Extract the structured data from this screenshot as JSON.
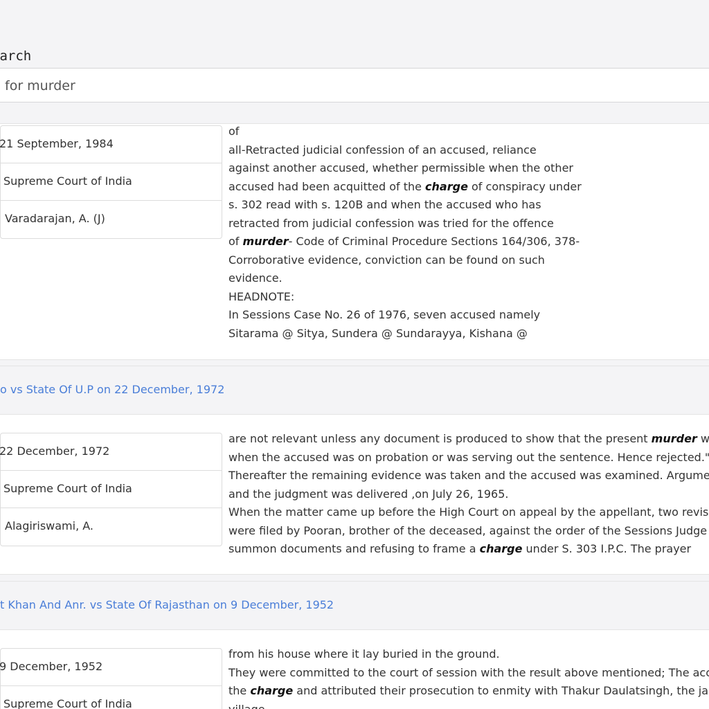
{
  "search": {
    "label": "earch",
    "query": "for murder"
  },
  "results": [
    {
      "title": "",
      "meta": {
        "date": "21 September, 1984",
        "court": "Supreme Court of India",
        "author": "Varadarajan, A. (J)"
      },
      "snippet_lines": [
        "of",
        "all-Retracted judicial confession of an accused, reliance",
        "against another accused, whether permissible when the other",
        [
          "accused had been acquitted of the ",
          {
            "em": "charge"
          },
          " of conspiracy under"
        ],
        "s. 302 read with s. 120B and when the accused who has",
        "retracted from judicial confession was tried for the offence",
        [
          "of ",
          {
            "em": "murder"
          },
          "- Code of Criminal Procedure Sections 164/306, 378-"
        ],
        "Corroborative evidence, conviction can be found on such",
        "evidence.",
        "HEADNOTE:",
        "In Sessions Case No. 26 of 1976, seven accused namely",
        "Sitarama @ Sitya, Sundera @ Sundarayya, Kishana @"
      ]
    },
    {
      "title": "o vs State Of U.P on 22 December, 1972",
      "meta": {
        "date": "22 December, 1972",
        "court": "Supreme Court of India",
        "author": "Alagiriswami, A."
      },
      "snippet_lines": [
        [
          "are not relevant unless any document is produced to show that the present ",
          {
            "em": "murder"
          },
          " was"
        ],
        "when the accused was on probation or was serving out the sentence. Hence rejected.\"",
        "Thereafter the remaining evidence was taken and the accused was examined. Arguments",
        "and the judgment was delivered ,on July 26, 1965.",
        "When the matter came up before the High Court on appeal by the appellant, two revisi",
        "were filed by Pooran, brother of the deceased, against the order of the Sessions Judge",
        [
          "summon documents and refusing to frame a ",
          {
            "em": "charge"
          },
          " under S. 303 I.P.C. The prayer"
        ]
      ]
    },
    {
      "title": "t Khan And Anr. vs State Of Rajasthan on 9 December, 1952",
      "meta": {
        "date": "9 December, 1952",
        "court": "Supreme Court of India",
        "author": ""
      },
      "snippet_lines": [
        "from his house where it lay buried in the ground.",
        "They were committed to the court of session with the result above mentioned; The accu",
        [
          "the ",
          {
            "em": "charge"
          },
          " and attributed their prosecution to enmity with Thakur Daulatsingh, the jag"
        ],
        "village"
      ]
    }
  ]
}
